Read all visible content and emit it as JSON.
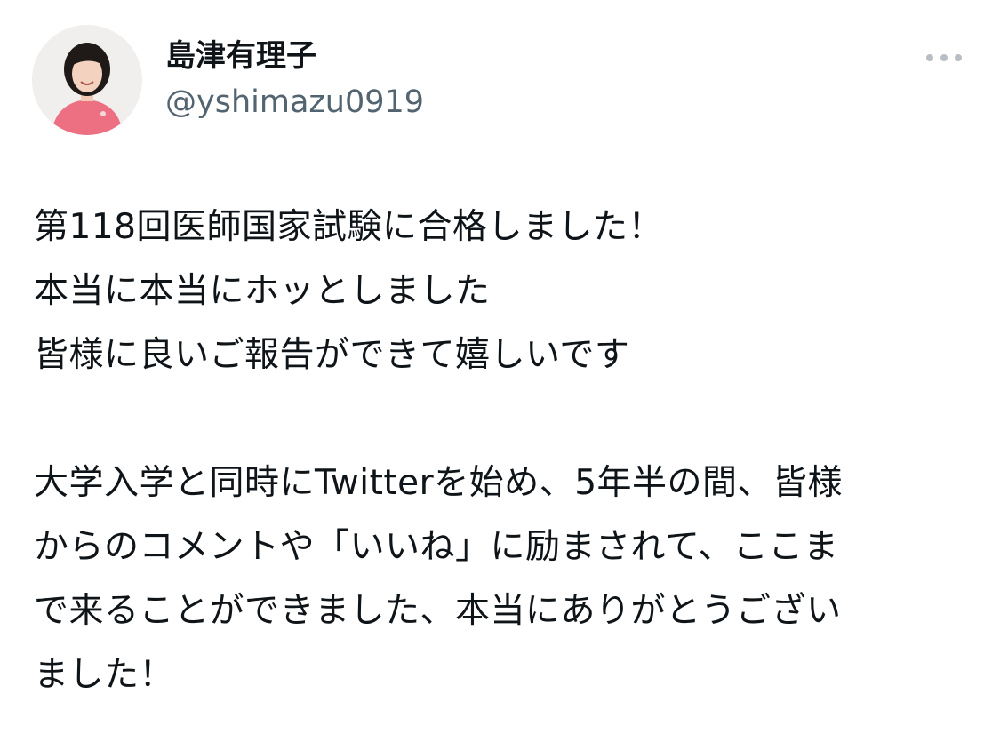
{
  "author": {
    "display_name": "島津有理子",
    "handle": "@yshimazu0919",
    "avatar_icon": "profile-photo-avatar"
  },
  "menu": {
    "icon": "more-horizontal-icon"
  },
  "tweet": {
    "paragraph1": [
      "第118回医師国家試験に合格しました！",
      "本当に本当にホッとしました",
      "皆様に良いご報告ができて嬉しいです"
    ],
    "paragraph2": [
      "大学入学と同時にTwitterを始め、5年半の間、皆様",
      "からのコメントや「いいね」に励まされて、ここま",
      "で来ることができました、本当にありがとうござい",
      "ました！"
    ]
  },
  "colors": {
    "text_primary": "#0f1419",
    "text_secondary": "#536471",
    "menu_dots": "#b9bec4"
  }
}
